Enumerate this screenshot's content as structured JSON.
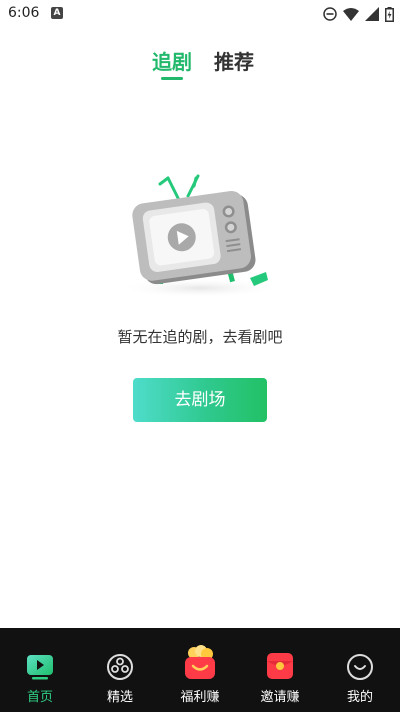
{
  "status_bar": {
    "time": "6:06",
    "notif": "A"
  },
  "tabs": [
    {
      "label": "追剧",
      "active": true
    },
    {
      "label": "推荐",
      "active": false
    }
  ],
  "empty_state": {
    "message": "暂无在追的剧，去看剧吧",
    "button_label": "去剧场"
  },
  "bottom_nav": [
    {
      "label": "首页",
      "icon": "home-tv-icon",
      "active": true
    },
    {
      "label": "精选",
      "icon": "film-reel-icon",
      "active": false
    },
    {
      "label": "福利赚",
      "icon": "coin-bag-icon",
      "active": false
    },
    {
      "label": "邀请赚",
      "icon": "red-envelope-icon",
      "active": false
    },
    {
      "label": "我的",
      "icon": "smile-icon",
      "active": false
    }
  ],
  "colors": {
    "accent": "#21b86b",
    "nav_bg": "#111111"
  }
}
